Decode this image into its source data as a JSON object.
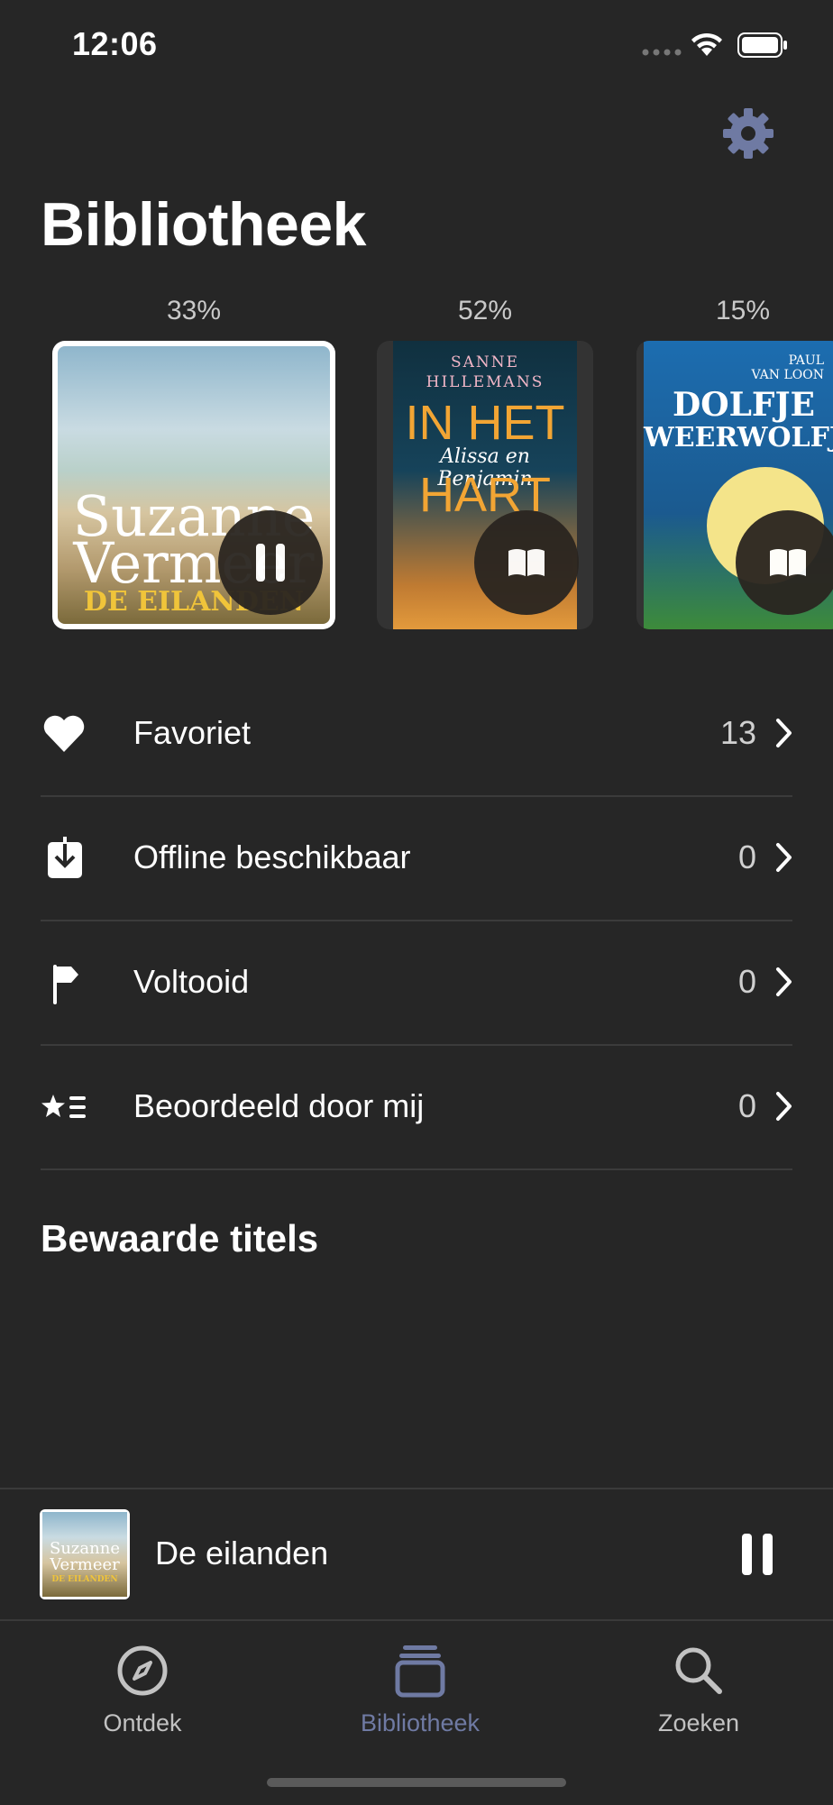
{
  "status_bar": {
    "time": "12:06"
  },
  "header": {
    "title": "Bibliotheek",
    "settings_icon": "gear-icon"
  },
  "carousel": [
    {
      "progress": "33%",
      "cover_text": [
        "Suzanne",
        "Vermeer",
        "DE EILANDEN"
      ],
      "action_icon": "pause-icon"
    },
    {
      "progress": "52%",
      "cover_text": [
        "SANNE",
        "HILLEMANS",
        "IN HET",
        "Alissa en Benjamin",
        "HART"
      ],
      "action_icon": "book-icon"
    },
    {
      "progress": "15%",
      "cover_text": [
        "PAUL",
        "VAN LOON",
        "DOLFJE",
        "WEERWOLFJE"
      ],
      "action_icon": "book-icon"
    }
  ],
  "list": [
    {
      "label": "Favoriet",
      "count": "13",
      "icon": "heart-icon"
    },
    {
      "label": "Offline beschikbaar",
      "count": "0",
      "icon": "download-icon"
    },
    {
      "label": "Voltooid",
      "count": "0",
      "icon": "flag-icon"
    },
    {
      "label": "Beoordeeld door mij",
      "count": "0",
      "icon": "star-list-icon"
    }
  ],
  "saved_section": {
    "title": "Bewaarde titels"
  },
  "mini_player": {
    "title": "De eilanden",
    "cover_text": [
      "Suzanne",
      "Vermeer",
      "DE EILANDEN"
    ],
    "action_icon": "pause-icon"
  },
  "tabs": [
    {
      "label": "Ontdek",
      "icon": "compass-icon",
      "active": false
    },
    {
      "label": "Bibliotheek",
      "icon": "library-icon",
      "active": true
    },
    {
      "label": "Zoeken",
      "icon": "search-icon",
      "active": false
    }
  ],
  "colors": {
    "background": "#262626",
    "accent": "#6f7aa3",
    "text": "#ffffff",
    "muted": "#c9c9c9"
  }
}
